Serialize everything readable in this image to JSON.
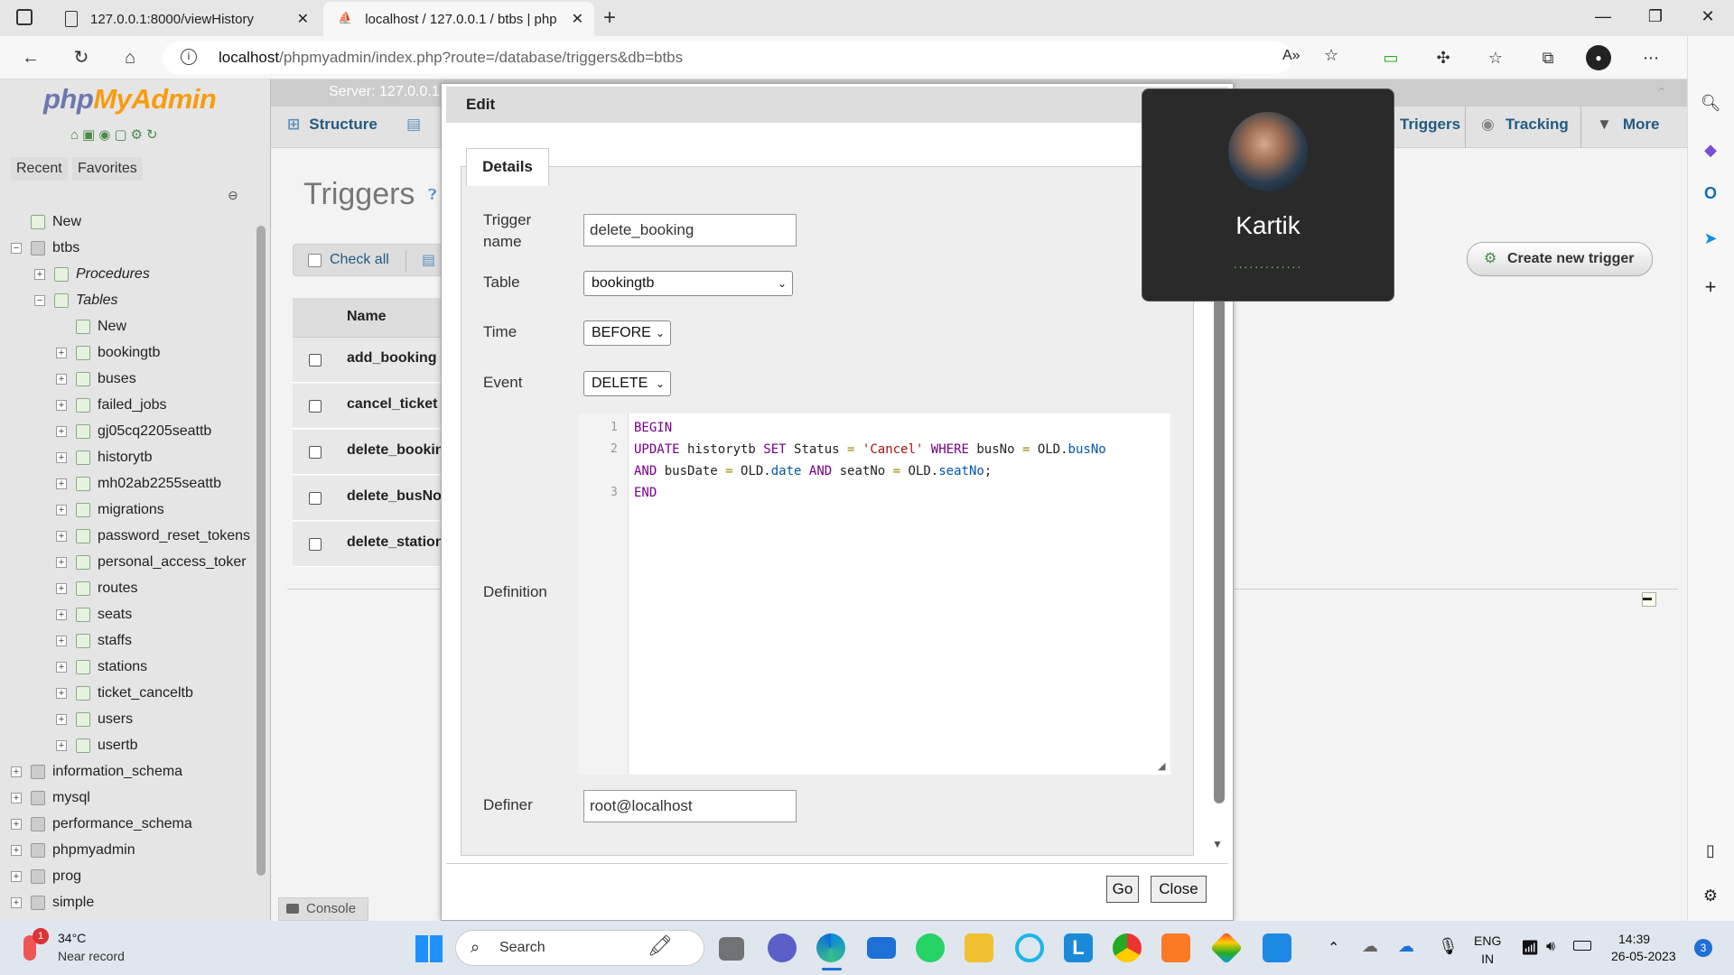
{
  "browser": {
    "tabs": [
      {
        "title": "127.0.0.1:8000/viewHistory",
        "active": false
      },
      {
        "title": "localhost / 127.0.0.1 / btbs | php",
        "active": true
      }
    ],
    "url_host": "localhost",
    "url_path": "/phpmyadmin/index.php?route=/database/triggers&db=btbs"
  },
  "pma": {
    "logo_php": "php",
    "logo_my": "MyAdmin",
    "nav_tabs": [
      "Recent",
      "Favorites"
    ],
    "tree": [
      {
        "label": "New",
        "type": "new",
        "level": 0
      },
      {
        "label": "btbs",
        "type": "db",
        "level": 0,
        "expanded": true
      },
      {
        "label": "Procedures",
        "type": "group",
        "level": 1
      },
      {
        "label": "Tables",
        "type": "group",
        "level": 1,
        "expanded": true
      },
      {
        "label": "New",
        "type": "new",
        "level": 2
      },
      {
        "label": "bookingtb",
        "type": "table",
        "level": 2
      },
      {
        "label": "buses",
        "type": "table",
        "level": 2
      },
      {
        "label": "failed_jobs",
        "type": "table",
        "level": 2
      },
      {
        "label": "gj05cq2205seattb",
        "type": "table",
        "level": 2
      },
      {
        "label": "historytb",
        "type": "table",
        "level": 2
      },
      {
        "label": "mh02ab2255seattb",
        "type": "table",
        "level": 2
      },
      {
        "label": "migrations",
        "type": "table",
        "level": 2
      },
      {
        "label": "password_reset_tokens",
        "type": "table",
        "level": 2
      },
      {
        "label": "personal_access_toker",
        "type": "table",
        "level": 2
      },
      {
        "label": "routes",
        "type": "table",
        "level": 2
      },
      {
        "label": "seats",
        "type": "table",
        "level": 2
      },
      {
        "label": "staffs",
        "type": "table",
        "level": 2
      },
      {
        "label": "stations",
        "type": "table",
        "level": 2
      },
      {
        "label": "ticket_canceltb",
        "type": "table",
        "level": 2
      },
      {
        "label": "users",
        "type": "table",
        "level": 2
      },
      {
        "label": "usertb",
        "type": "table",
        "level": 2
      },
      {
        "label": "information_schema",
        "type": "db",
        "level": 0
      },
      {
        "label": "mysql",
        "type": "db",
        "level": 0
      },
      {
        "label": "performance_schema",
        "type": "db",
        "level": 0
      },
      {
        "label": "phpmyadmin",
        "type": "db",
        "level": 0
      },
      {
        "label": "prog",
        "type": "db",
        "level": 0
      },
      {
        "label": "simple",
        "type": "db",
        "level": 0
      }
    ],
    "server_label": "Server: 127.0.0.1",
    "menu_tabs": {
      "structure": "Structure",
      "triggers": "Triggers",
      "tracking": "Tracking",
      "more": "More"
    },
    "page_title": "Triggers",
    "check_all": "Check all",
    "col_name": "Name",
    "triggers": [
      "add_booking",
      "cancel_ticket",
      "delete_booking",
      "delete_busNo",
      "delete_station"
    ],
    "create_button": "Create new trigger",
    "console": "Console"
  },
  "modal": {
    "title": "Edit",
    "tab": "Details",
    "labels": {
      "trigger_name_1": "Trigger",
      "trigger_name_2": "name",
      "table": "Table",
      "time": "Time",
      "event": "Event",
      "definition": "Definition",
      "definer": "Definer"
    },
    "values": {
      "trigger_name": "delete_booking",
      "table": "bookingtb",
      "time": "BEFORE",
      "event": "DELETE",
      "definer": "root@localhost"
    },
    "code_line_numbers": [
      "1",
      "2",
      "3"
    ],
    "buttons": {
      "go": "Go",
      "close": "Close"
    }
  },
  "call_overlay": {
    "name": "Kartik",
    "status_dots": "............."
  },
  "taskbar": {
    "weather_temp": "34°C",
    "weather_desc": "Near record",
    "search": "Search",
    "lang1": "ENG",
    "lang2": "IN",
    "time": "14:39",
    "date": "26-05-2023",
    "notif_count": "3",
    "weather_badge": "1"
  }
}
